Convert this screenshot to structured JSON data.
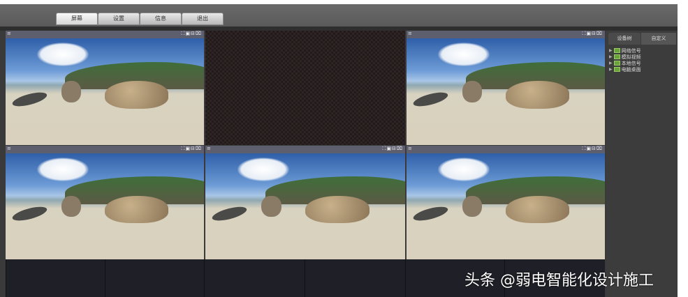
{
  "tabs": [
    {
      "label": "屏幕",
      "active": true
    },
    {
      "label": "设置"
    },
    {
      "label": "信息"
    },
    {
      "label": "退出"
    }
  ],
  "window_controls": "⛶▣⊟⌧",
  "window_menu": "≡",
  "side_tabs": [
    "设备树",
    "自定义"
  ],
  "tree": [
    "网络信号",
    "模拟视频",
    "本地信号",
    "电脑桌面"
  ],
  "watermark": "头条 @弱电智能化设计施工"
}
